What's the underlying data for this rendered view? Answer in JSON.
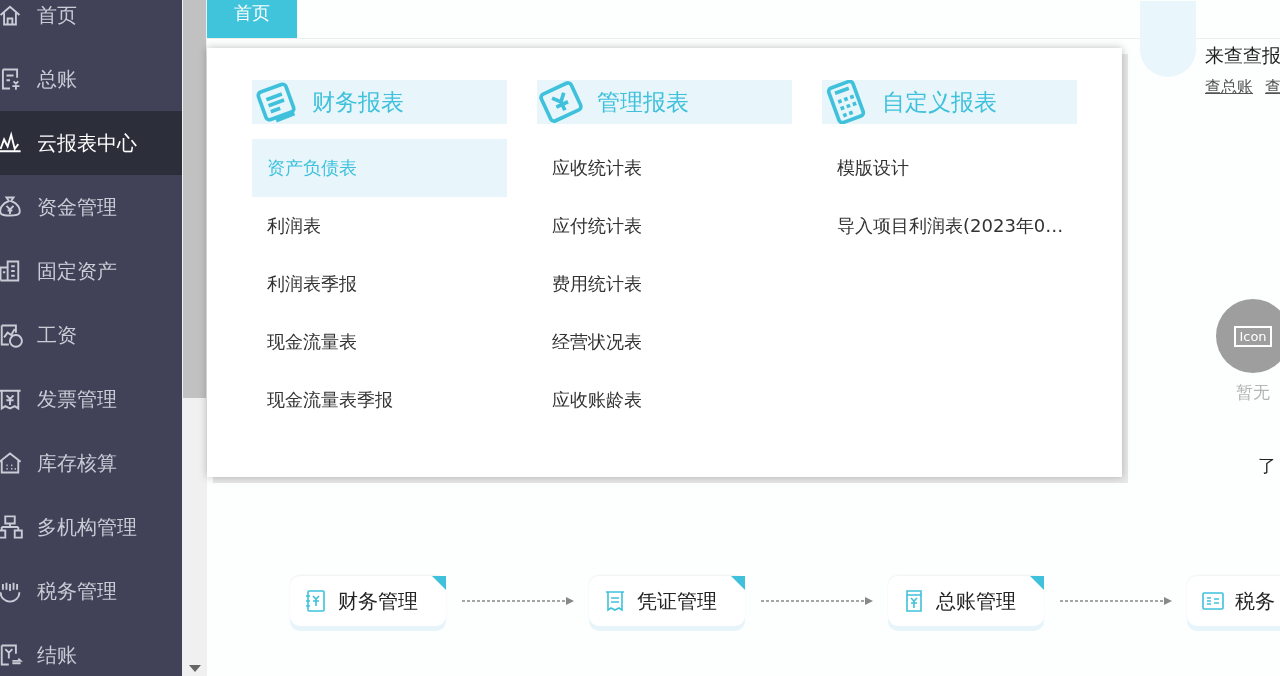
{
  "sidebar": {
    "items": [
      {
        "label": "首页",
        "selected": false
      },
      {
        "label": "总账",
        "selected": false
      },
      {
        "label": "云报表中心",
        "selected": true
      },
      {
        "label": "资金管理",
        "selected": false
      },
      {
        "label": "固定资产",
        "selected": false
      },
      {
        "label": "工资",
        "selected": false
      },
      {
        "label": "发票管理",
        "selected": false
      },
      {
        "label": "库存核算",
        "selected": false
      },
      {
        "label": "多机构管理",
        "selected": false
      },
      {
        "label": "税务管理",
        "selected": false
      },
      {
        "label": "结账",
        "selected": false
      }
    ]
  },
  "tabs": [
    {
      "label": "首页",
      "selected": true
    }
  ],
  "summary": {
    "title": "来查查报",
    "links": [
      "查总账",
      "查"
    ]
  },
  "empty_state": {
    "icon_label": "Icon",
    "text": "暂无"
  },
  "side_text": "了",
  "flow": {
    "steps": [
      "财务管理",
      "凭证管理",
      "总账管理",
      "税务"
    ]
  },
  "menu": {
    "columns": [
      {
        "title": "财务报表",
        "items": [
          {
            "label": "资产负债表",
            "selected": true
          },
          {
            "label": "利润表",
            "selected": false
          },
          {
            "label": "利润表季报",
            "selected": false
          },
          {
            "label": "现金流量表",
            "selected": false
          },
          {
            "label": "现金流量表季报",
            "selected": false
          }
        ]
      },
      {
        "title": "管理报表",
        "items": [
          {
            "label": "应收统计表",
            "selected": false
          },
          {
            "label": "应付统计表",
            "selected": false
          },
          {
            "label": "费用统计表",
            "selected": false
          },
          {
            "label": "经营状况表",
            "selected": false
          },
          {
            "label": "应收账龄表",
            "selected": false
          }
        ]
      },
      {
        "title": "自定义报表",
        "items": [
          {
            "label": "模版设计",
            "selected": false
          },
          {
            "label": "导入项目利润表(2023年0…",
            "selected": false
          }
        ]
      }
    ]
  }
}
